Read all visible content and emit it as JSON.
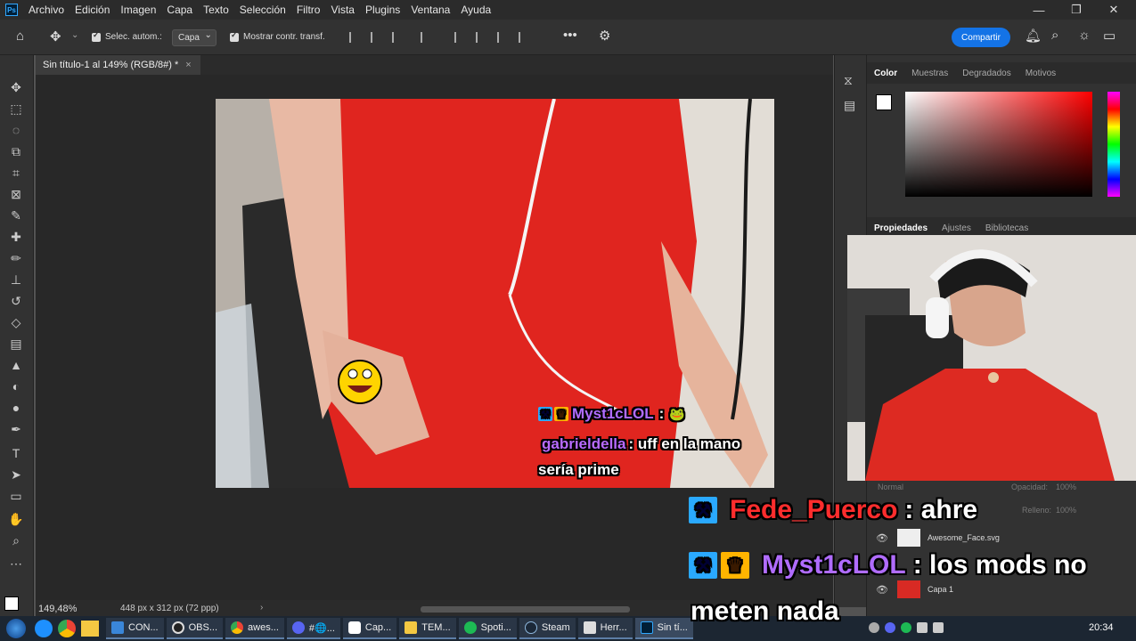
{
  "menu": [
    "Archivo",
    "Edición",
    "Imagen",
    "Capa",
    "Texto",
    "Selección",
    "Filtro",
    "Vista",
    "Plugins",
    "Ventana",
    "Ayuda"
  ],
  "app_logo": "Ps",
  "options": {
    "auto_select_label": "Selec. autom.:",
    "auto_select_value": "Capa",
    "show_transform_label": "Mostrar contr. transf.",
    "share_label": "Compartir"
  },
  "document": {
    "tab_title": "Sin título-1 al 149% (RGB/8#) *",
    "zoom": "149,48%",
    "size_info": "448 px x 312 px (72 ppp)"
  },
  "color_panel": {
    "tabs": [
      "Color",
      "Muestras",
      "Degradados",
      "Motivos"
    ]
  },
  "properties_panel": {
    "tabs": [
      "Propiedades",
      "Ajustes",
      "Bibliotecas"
    ]
  },
  "layers": {
    "blend_mode": "Normal",
    "opacity_label": "Opacidad:",
    "opacity_value": "100%",
    "fill_label": "Relleno:",
    "fill_value": "100%",
    "items": [
      {
        "name": "Awesome_Face.svg"
      },
      {
        "name": "Capa 1"
      }
    ]
  },
  "stream_chat_small": [
    {
      "user": "Myst1cLOL",
      "message": ":"
    },
    {
      "user": "gabrieldella",
      "message": ": uff en la mano"
    },
    {
      "user": "",
      "message": "sería prime"
    }
  ],
  "stream_chat_large": [
    {
      "user": "Fede_Puerco",
      "message": ": ahre"
    },
    {
      "user": "Myst1cLOL",
      "message": ": los mods no"
    },
    {
      "user": "",
      "message": "meten nada"
    }
  ],
  "taskbar": {
    "items": [
      "CON...",
      "OBS...",
      "awes...",
      "#🌐...",
      "Cap...",
      "TEM...",
      "Spoti...",
      "Steam",
      "Herr...",
      "Sin tí..."
    ],
    "clock": "20:34"
  },
  "colors": {
    "accent": "#1473e6",
    "fede_name": "#ff2d2d",
    "myst_name": "#b06cff",
    "gabriel_name": "#b86bff"
  }
}
